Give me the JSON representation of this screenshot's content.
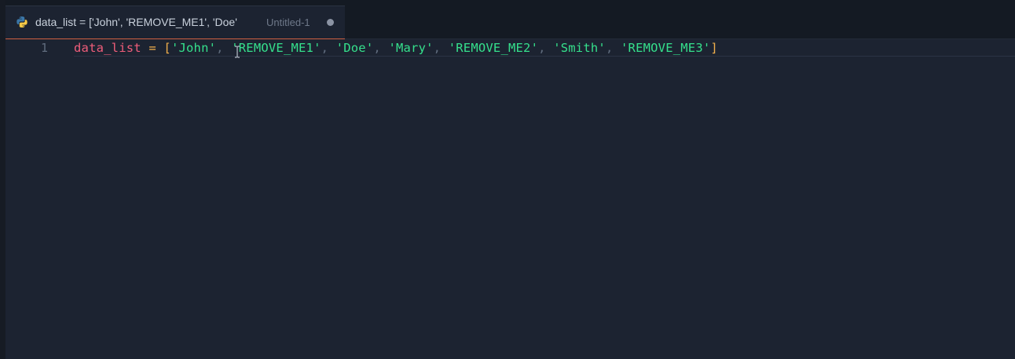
{
  "tab": {
    "title": "data_list = ['John', 'REMOVE_ME1', 'Doe'",
    "description": "Untitled-1",
    "language_icon": "python-icon",
    "modified": true
  },
  "editor": {
    "lines": [
      {
        "number": "1",
        "tokens": {
          "var": "data_list",
          "eq": " = ",
          "open": "[",
          "s1": "'John'",
          "c1": ", ",
          "s2": "'REMOVE_ME1'",
          "c2": ", ",
          "s3": "'Doe'",
          "c3": ", ",
          "s4": "'Mary'",
          "c4": ", ",
          "s5": "'REMOVE_ME2'",
          "c5": ", ",
          "s6": "'Smith'",
          "c6": ", ",
          "s7": "'REMOVE_ME3'",
          "close": "]"
        }
      }
    ]
  },
  "colors": {
    "background": "#1c2331",
    "tabbar": "#141a23",
    "active_tab_border": "#d06042",
    "variable": "#ef5d7a",
    "operator": "#f2b04c",
    "string": "#35e08c",
    "punctuation": "#5f6b7d"
  }
}
